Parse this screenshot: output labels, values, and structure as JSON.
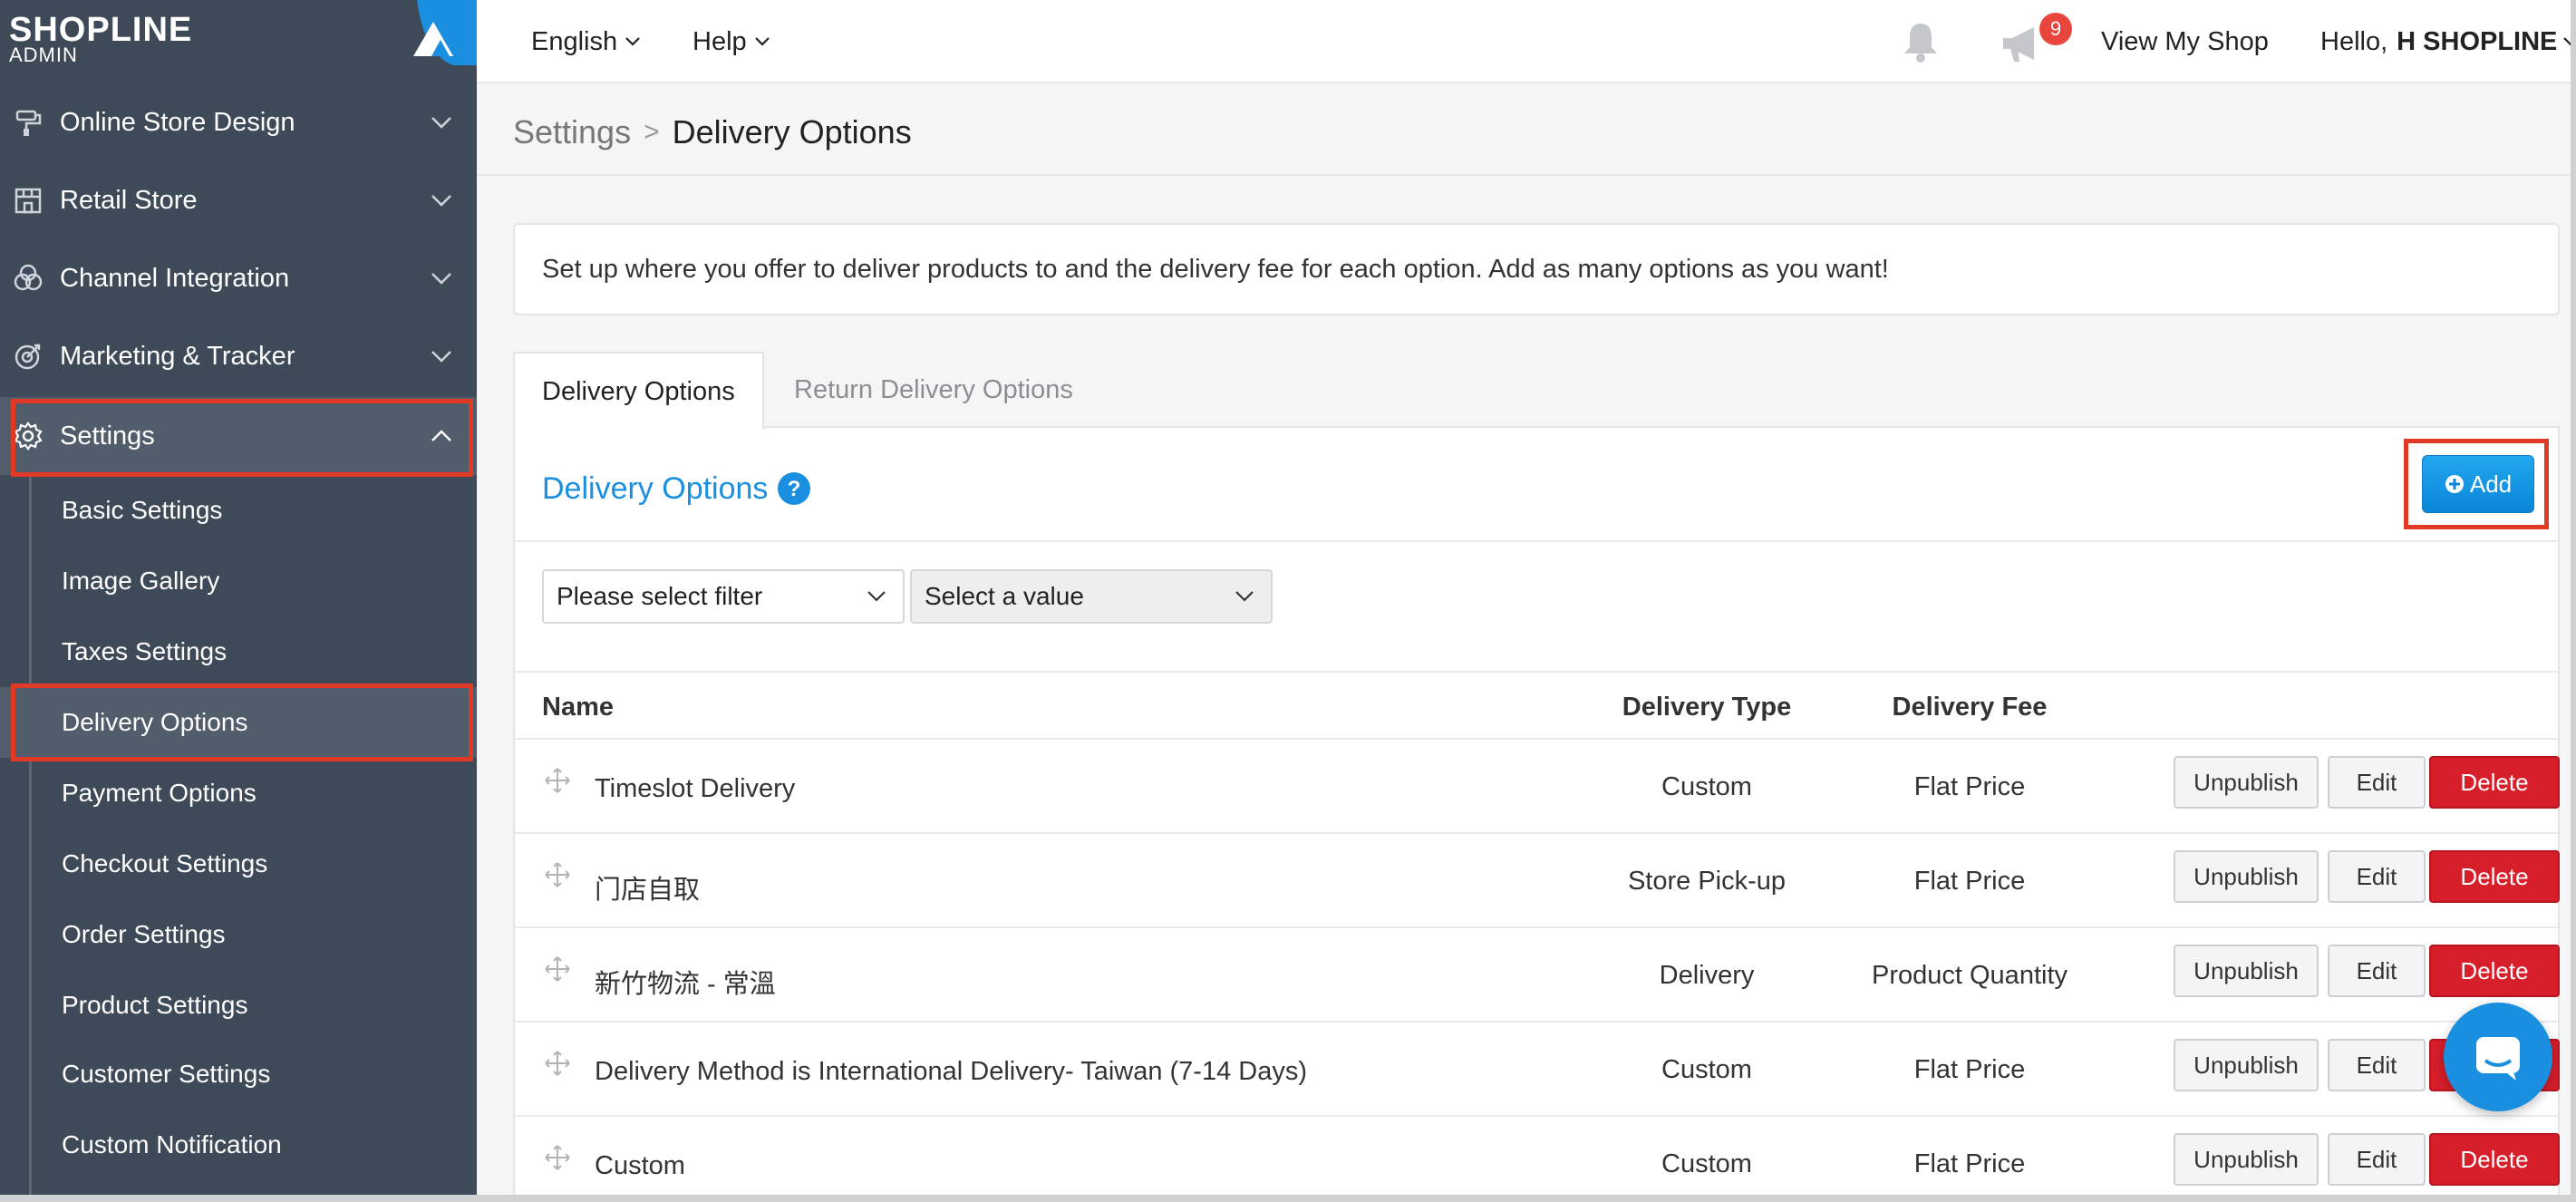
{
  "brand": {
    "logo_text": "SHOPLINE",
    "logo_sub": "ADMIN"
  },
  "sidebar": {
    "sections": [
      {
        "label": "Online Store Design",
        "icon": "paint-roller-icon"
      },
      {
        "label": "Retail Store",
        "icon": "storefront-icon"
      },
      {
        "label": "Channel Integration",
        "icon": "channels-icon"
      },
      {
        "label": "Marketing & Tracker",
        "icon": "target-icon"
      },
      {
        "label": "Settings",
        "icon": "gear-icon",
        "expanded": true
      }
    ],
    "settings_items": [
      {
        "label": "Basic Settings"
      },
      {
        "label": "Image Gallery"
      },
      {
        "label": "Taxes Settings"
      },
      {
        "label": "Delivery Options",
        "active": true
      },
      {
        "label": "Payment Options"
      },
      {
        "label": "Checkout Settings"
      },
      {
        "label": "Order Settings"
      },
      {
        "label": "Product Settings"
      },
      {
        "label": "Customer Settings"
      },
      {
        "label": "Custom Notification"
      }
    ]
  },
  "topbar": {
    "language": "English",
    "help": "Help",
    "notification_count": "9",
    "view_shop": "View My Shop",
    "greeting": "Hello,",
    "user_name": "H SHOPLINE"
  },
  "breadcrumb": {
    "root": "Settings",
    "separator": ">",
    "current": "Delivery Options"
  },
  "info_text": "Set up where you offer to deliver products to and the delivery fee for each option. Add as many options as you want!",
  "tabs": [
    {
      "label": "Delivery Options",
      "active": true
    },
    {
      "label": "Return Delivery Options",
      "active": false
    }
  ],
  "panel": {
    "title": "Delivery Options",
    "add_label": "Add",
    "filter_placeholder": "Please select filter",
    "value_placeholder": "Select a value"
  },
  "table": {
    "columns": [
      "Name",
      "Delivery Type",
      "Delivery Fee"
    ],
    "rows": [
      {
        "name": "Timeslot Delivery",
        "type": "Custom",
        "fee": "Flat Price"
      },
      {
        "name": "门店自取",
        "type": "Store Pick-up",
        "fee": "Flat Price"
      },
      {
        "name": "新竹物流 - 常溫",
        "type": "Delivery",
        "fee": "Product Quantity"
      },
      {
        "name": "Delivery Method is International Delivery- Taiwan (7-14 Days)",
        "type": "Custom",
        "fee": "Flat Price"
      },
      {
        "name": "Custom",
        "type": "Custom",
        "fee": "Flat Price"
      }
    ],
    "actions": {
      "unpublish": "Unpublish",
      "edit": "Edit",
      "delete": "Delete"
    }
  },
  "colors": {
    "sidebar_bg": "#3f4a59",
    "accent_blue": "#1a8fe0",
    "delete_red": "#d71e2b",
    "highlight_red": "#e03a26"
  }
}
